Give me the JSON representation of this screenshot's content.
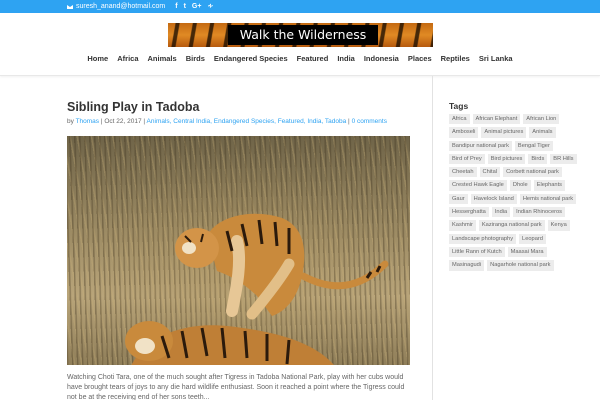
{
  "topbar": {
    "email": "suresh_anand@hotmail.com",
    "social": [
      "f",
      "t",
      "G+",
      "rss"
    ],
    "accent": "#2ea3f2"
  },
  "header": {
    "logo_text": "Walk the Wilderness",
    "nav": [
      "Home",
      "Africa",
      "Animals",
      "Birds",
      "Endangered Species",
      "Featured",
      "India",
      "Indonesia",
      "Places",
      "Reptiles",
      "Sri Lanka"
    ]
  },
  "post": {
    "title": "Sibling Play in Tadoba",
    "meta": {
      "by": "by ",
      "author": "Thomas",
      "sep1": " | ",
      "date": "Oct 22, 2017",
      "sep2": " | ",
      "categories": "Animals, Central India, Endangered Species, Featured, India, Tadoba",
      "sep3": " | ",
      "comments": "0 comments"
    },
    "excerpt": "Watching Choti Tara, one of the much sought after Tigress in Tadoba National Park, play with her cubs would have brought tears of joys to any die hard wildlife enthusiast. Soon it reached a point where the Tigress could not be at the receiving end of her sons teeth..."
  },
  "sidebar": {
    "heading": "Tags",
    "tags": [
      "Africa",
      "African Elephant",
      "African Lion",
      "Amboseli",
      "Animal pictures",
      "Animals",
      "Bandipur national park",
      "Bengal Tiger",
      "Bird of Prey",
      "Bird pictures",
      "Birds",
      "BR Hills",
      "Cheetah",
      "Chital",
      "Corbett national park",
      "Crested Hawk Eagle",
      "Dhole",
      "Elephants",
      "Gaur",
      "Havelock Island",
      "Hemis national park",
      "Hesserghatta",
      "India",
      "Indian Rhinoceros",
      "Kashmir",
      "Kaziranga national park",
      "Kenya",
      "Landscape photography",
      "Leopard",
      "Little Rann of Kutch",
      "Maasai Mara",
      "Masinagudi",
      "Nagarhole national park"
    ]
  }
}
